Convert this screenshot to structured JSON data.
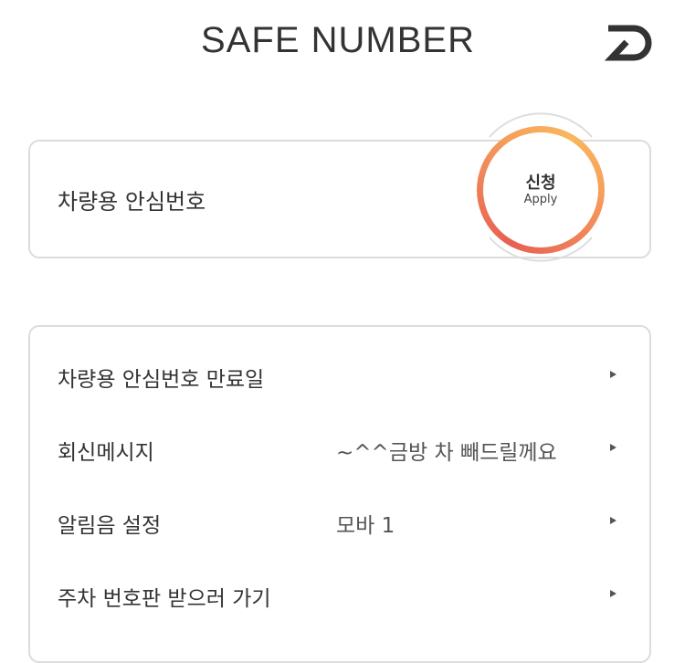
{
  "header": {
    "title": "SAFE NUMBER",
    "back_icon": "return-icon"
  },
  "apply_card": {
    "label": "차량용 안심번호",
    "button_ko": "신청",
    "button_en": "Apply",
    "ring_colors": [
      "#f9b75e",
      "#e85f52"
    ]
  },
  "settings": {
    "rows": [
      {
        "label": "차량용 안심번호 만료일",
        "value": ""
      },
      {
        "label": "회신메시지",
        "value": "~^^금방 차 빼드릴께요"
      },
      {
        "label": "알림음 설정",
        "value": "모바 1"
      },
      {
        "label": "주차 번호판 받으러 가기",
        "value": ""
      }
    ]
  }
}
